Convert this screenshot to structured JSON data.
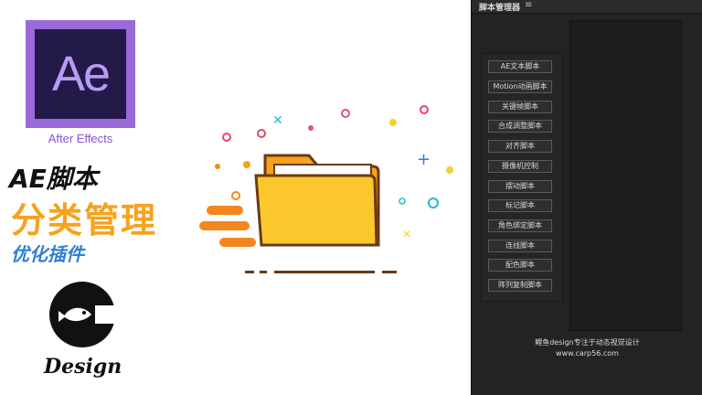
{
  "left": {
    "ae_logo_text": "Ae",
    "ae_caption": "After Effects",
    "title_line1": "AE脚本",
    "title_line2": "分类管理",
    "title_line3": "优化插件",
    "brand_text": "Design"
  },
  "panel": {
    "title": "脚本管理器",
    "menu_icon": "hamburger-menu-icon",
    "buttons": [
      "AE文本脚本",
      "Motion动画脚本",
      "关键帧脚本",
      "合成调整脚本",
      "对齐脚本",
      "摄像机控制",
      "摆动脚本",
      "标记脚本",
      "角色绑定脚本",
      "连线脚本",
      "配色脚本",
      "阵列复制脚本"
    ],
    "footer_line1": "鲤鱼design专注于动态视觉设计",
    "footer_line2": "www.carp56.com"
  },
  "colors": {
    "ae_purple": "#9a6ad8",
    "ae_dark": "#241a4a",
    "orange": "#f6a21b",
    "blue": "#2f7fd6",
    "panel_bg": "#232323"
  }
}
